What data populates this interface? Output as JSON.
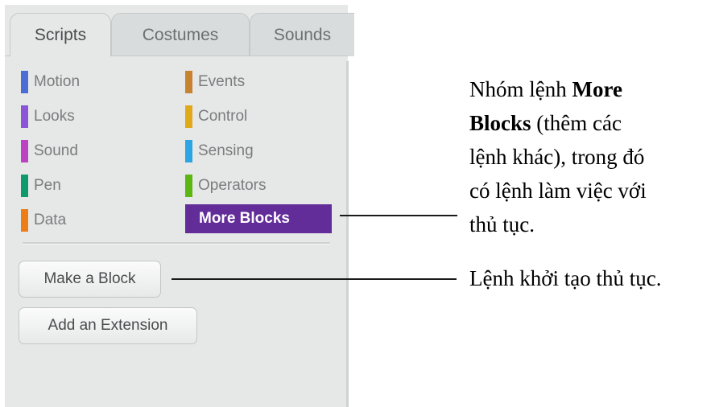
{
  "tabs": [
    {
      "label": "Scripts",
      "active": true
    },
    {
      "label": "Costumes",
      "active": false
    },
    {
      "label": "Sounds",
      "active": false
    }
  ],
  "categories": {
    "left": [
      {
        "label": "Motion",
        "color": "#4a6cd4"
      },
      {
        "label": "Looks",
        "color": "#8a55d7"
      },
      {
        "label": "Sound",
        "color": "#bb42c3"
      },
      {
        "label": "Pen",
        "color": "#0e9a6c"
      },
      {
        "label": "Data",
        "color": "#ee7d16"
      }
    ],
    "right": [
      {
        "label": "Events",
        "color": "#c88330"
      },
      {
        "label": "Control",
        "color": "#e1a91a"
      },
      {
        "label": "Sensing",
        "color": "#2ca5e2"
      },
      {
        "label": "Operators",
        "color": "#5cb712"
      },
      {
        "label": "More Blocks",
        "color": "#632d99",
        "selected": true
      }
    ]
  },
  "buttons": {
    "make_block": "Make a Block",
    "add_extension": "Add an Extension"
  },
  "annotations": {
    "more_blocks_note": {
      "line1_pre": "Nhóm lệnh ",
      "line1_bold": "More",
      "line2_bold": "Blocks",
      "line2_post": " (thêm các",
      "line3": "lệnh khác), trong đó",
      "line4": "có lệnh làm việc với",
      "line5": "thủ tục."
    },
    "make_block_note": "Lệnh khởi tạo thủ tục."
  }
}
